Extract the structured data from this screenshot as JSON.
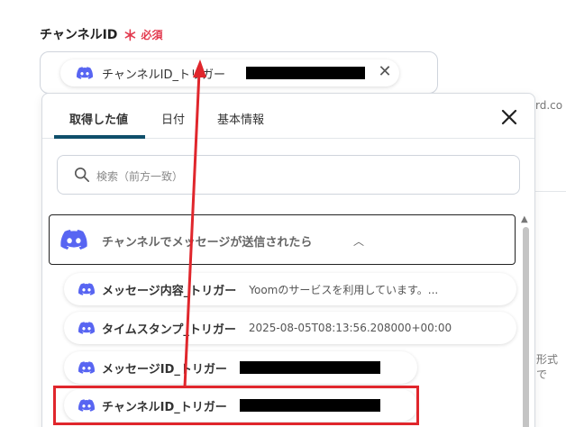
{
  "field": {
    "label": "チャンネルID",
    "required_mark": "＊",
    "required_text": "必須"
  },
  "chip": {
    "icon": "discord-icon",
    "label": "チャンネルID_トリガー",
    "close": "✕"
  },
  "background": {
    "text1": "rd.co",
    "text2": "形式で"
  },
  "tabs": [
    {
      "label": "取得した値"
    },
    {
      "label": "日付"
    },
    {
      "label": "基本情報"
    }
  ],
  "search": {
    "placeholder": "検索（前方一致）"
  },
  "section": {
    "title": "チャンネルでメッセージが送信されたら",
    "chevron": "^"
  },
  "items": [
    {
      "name": "メッセージ内容_トリガー",
      "value": "Yoomのサービスを利用しています。..."
    },
    {
      "name": "タイムスタンプ_トリガー",
      "value": "2025-08-05T08:13:56.208000+00:00"
    },
    {
      "name": "メッセージID_トリガー",
      "value": ""
    },
    {
      "name": "チャンネルID_トリガー",
      "value": ""
    }
  ],
  "colors": {
    "accent": "#0f4f6b",
    "required": "#e2394e",
    "discord": "#5865f2",
    "annotation": "#e0262c"
  }
}
